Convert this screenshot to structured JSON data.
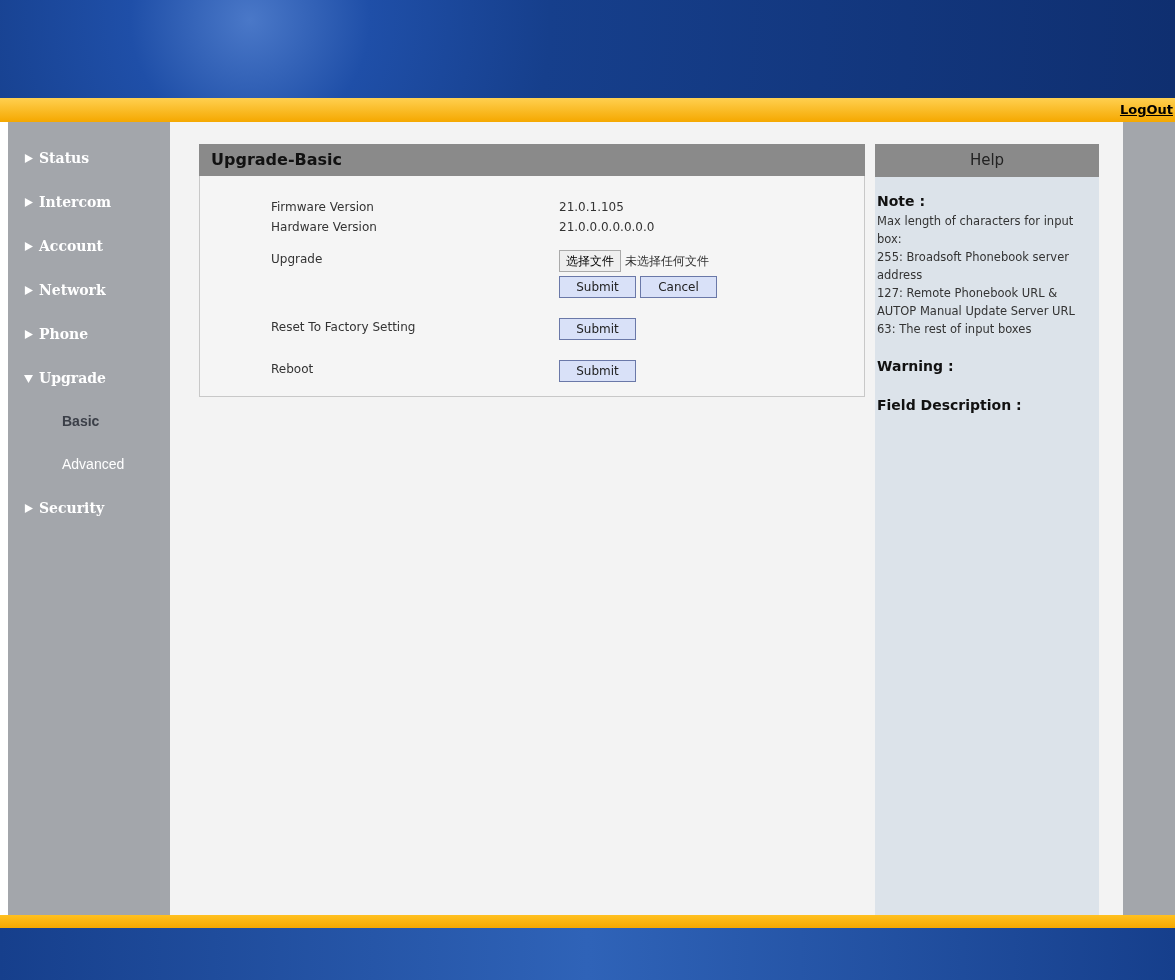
{
  "header": {
    "logout": "LogOut"
  },
  "sidebar": {
    "items": [
      {
        "label": "Status",
        "expanded": false
      },
      {
        "label": "Intercom",
        "expanded": false
      },
      {
        "label": "Account",
        "expanded": false
      },
      {
        "label": "Network",
        "expanded": false
      },
      {
        "label": "Phone",
        "expanded": false
      },
      {
        "label": "Upgrade",
        "expanded": true,
        "children": [
          {
            "label": "Basic",
            "selected": true
          },
          {
            "label": "Advanced",
            "selected": false
          }
        ]
      },
      {
        "label": "Security",
        "expanded": false
      }
    ]
  },
  "panel": {
    "title": "Upgrade-Basic",
    "rows": [
      {
        "kind": "info",
        "label": "Firmware Version",
        "value": "21.0.1.105"
      },
      {
        "kind": "info",
        "label": "Hardware Version",
        "value": "21.0.0.0.0.0.0.0"
      },
      {
        "kind": "file",
        "label": "Upgrade",
        "file_button": "选择文件",
        "file_status": "未选择任何文件",
        "buttons": [
          "Submit",
          "Cancel"
        ]
      },
      {
        "kind": "action",
        "label": "Reset To Factory Setting",
        "buttons": [
          "Submit"
        ]
      },
      {
        "kind": "action",
        "label": "Reboot",
        "buttons": [
          "Submit"
        ]
      }
    ]
  },
  "help": {
    "title": "Help",
    "sections": [
      {
        "heading": "Note :",
        "lines": [
          "Max length of characters for input box:",
          "255: Broadsoft Phonebook server address",
          "127: Remote Phonebook URL & AUTOP Manual Update Server URL",
          "63: The rest of input boxes"
        ]
      },
      {
        "heading": "Warning :"
      },
      {
        "heading": "Field Description :"
      }
    ]
  }
}
